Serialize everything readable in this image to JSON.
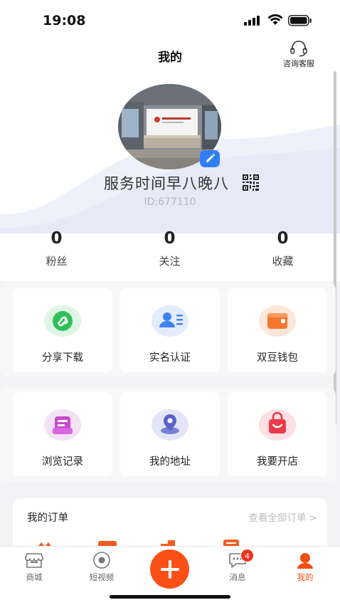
{
  "status_bar": {
    "time": "19:08"
  },
  "header": {
    "title": "我的",
    "service_label": "咨询客服"
  },
  "profile": {
    "username": "服务时间早八晚八",
    "user_id": "ID:677110"
  },
  "stats": [
    {
      "value": "0",
      "label": "粉丝"
    },
    {
      "value": "0",
      "label": "关注"
    },
    {
      "value": "0",
      "label": "收藏"
    }
  ],
  "services_row1": [
    {
      "label": "分享下载",
      "icon": "share-link-icon"
    },
    {
      "label": "实名认证",
      "icon": "id-card-icon"
    },
    {
      "label": "双豆钱包",
      "icon": "wallet-icon"
    }
  ],
  "services_row2": [
    {
      "label": "浏览记录",
      "icon": "history-icon"
    },
    {
      "label": "我的地址",
      "icon": "location-icon"
    },
    {
      "label": "我要开店",
      "icon": "shop-bag-icon"
    }
  ],
  "orders": {
    "title": "我的订单",
    "view_all": "查看全部订单 >"
  },
  "tabs": [
    {
      "label": "商城",
      "icon": "store-icon"
    },
    {
      "label": "短视频",
      "icon": "video-icon"
    },
    {
      "label": "",
      "icon": "plus-icon"
    },
    {
      "label": "消息",
      "icon": "message-icon",
      "badge": "4"
    },
    {
      "label": "我的",
      "icon": "profile-icon",
      "active": true
    }
  ],
  "colors": {
    "accent": "#f04e12",
    "plus_button": "#fb5015",
    "badge": "#f0341f",
    "edit_badge": "#2f7ef4"
  }
}
